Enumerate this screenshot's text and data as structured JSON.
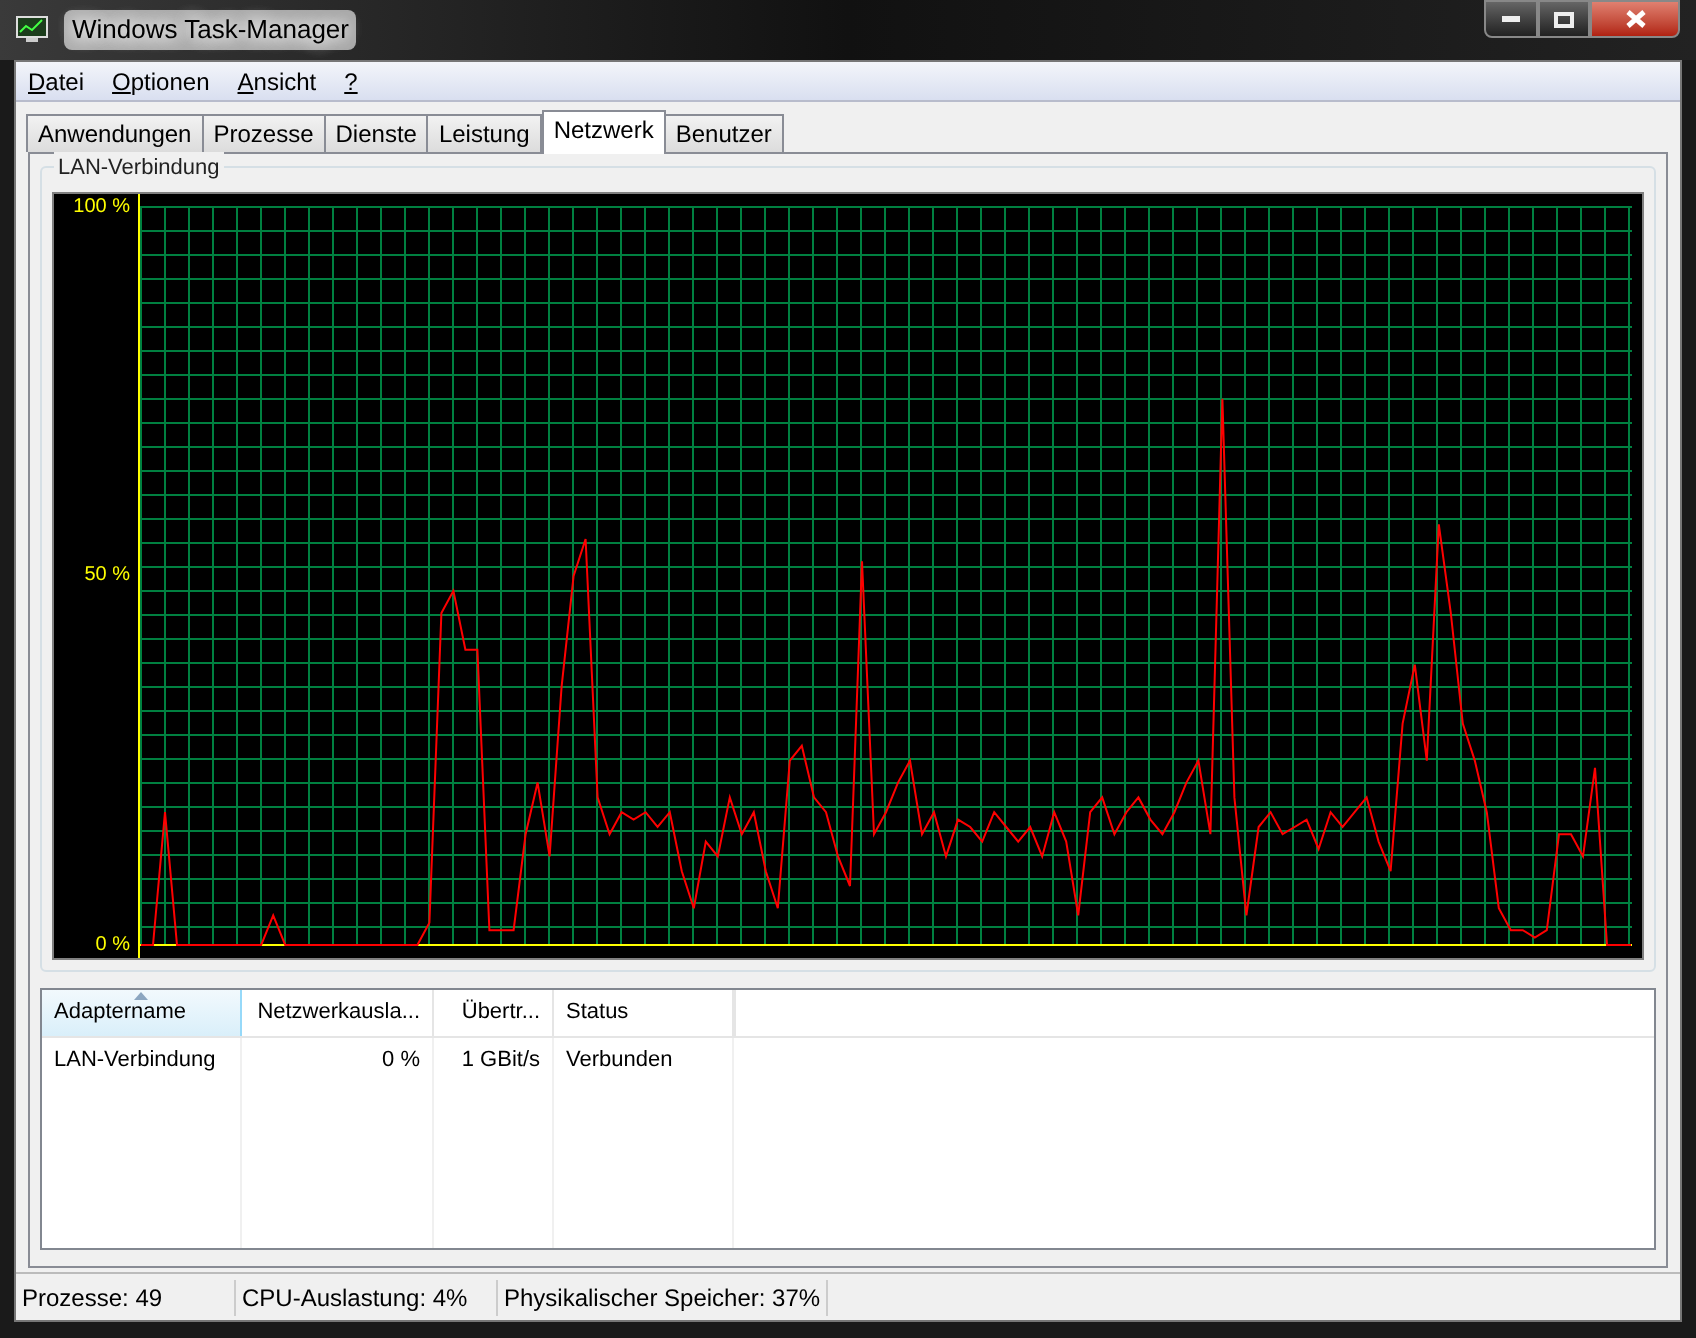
{
  "window": {
    "title": "Windows Task-Manager"
  },
  "menu": [
    {
      "label": "Datei"
    },
    {
      "label": "Optionen"
    },
    {
      "label": "Ansicht"
    },
    {
      "label": "?"
    }
  ],
  "tabs": [
    {
      "label": "Anwendungen",
      "selected": false
    },
    {
      "label": "Prozesse",
      "selected": false
    },
    {
      "label": "Dienste",
      "selected": false
    },
    {
      "label": "Leistung",
      "selected": false
    },
    {
      "label": "Netzwerk",
      "selected": true
    },
    {
      "label": "Benutzer",
      "selected": false
    }
  ],
  "graph": {
    "title": "LAN-Verbindung",
    "chart_data": {
      "type": "line",
      "ylim": [
        0,
        100
      ],
      "yticks": [
        {
          "value": 100,
          "label": "100 %"
        },
        {
          "value": 50,
          "label": "50 %"
        },
        {
          "value": 0,
          "label": "0 %"
        }
      ],
      "series": [
        {
          "color": "#ff0000",
          "values": [
            0,
            0,
            18,
            0,
            0,
            0,
            0,
            0,
            0,
            0,
            0,
            4,
            0,
            0,
            0,
            0,
            0,
            0,
            0,
            0,
            0,
            0,
            0,
            0,
            3,
            45,
            48,
            40,
            40,
            2,
            2,
            2,
            15,
            22,
            12,
            35,
            50,
            55,
            20,
            15,
            18,
            17,
            18,
            16,
            18,
            10,
            5,
            14,
            12,
            20,
            15,
            18,
            10,
            5,
            25,
            27,
            20,
            18,
            12,
            8,
            52,
            15,
            18,
            22,
            25,
            15,
            18,
            12,
            17,
            16,
            14,
            18,
            16,
            14,
            16,
            12,
            18,
            14,
            4,
            18,
            20,
            15,
            18,
            20,
            17,
            15,
            18,
            22,
            25,
            15,
            74,
            20,
            4,
            16,
            18,
            15,
            16,
            17,
            13,
            18,
            16,
            18,
            20,
            14,
            10,
            30,
            38,
            25,
            57,
            45,
            30,
            25,
            18,
            5,
            2,
            2,
            1,
            2,
            15,
            15,
            12,
            24,
            0,
            0,
            0
          ]
        }
      ]
    }
  },
  "table": {
    "columns": [
      {
        "label": "Adaptername",
        "sorted": true
      },
      {
        "label": "Netzwerkausla...",
        "sorted": false
      },
      {
        "label": "Übertr...",
        "sorted": false
      },
      {
        "label": "Status",
        "sorted": false
      }
    ],
    "rows": [
      [
        "LAN-Verbindung",
        "0 %",
        "1 GBit/s",
        "Verbunden"
      ]
    ]
  },
  "status_bar": [
    "Prozesse: 49",
    "CPU-Auslastung: 4%",
    "Physikalischer Speicher: 37%"
  ]
}
